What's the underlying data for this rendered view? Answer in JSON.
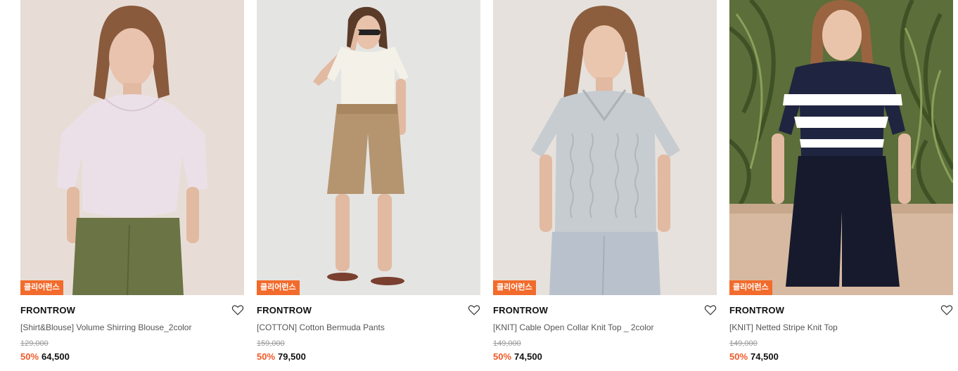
{
  "colors": {
    "badge": "#f26b2c",
    "discount": "#f05a28"
  },
  "products": [
    {
      "badge": "클리어런스",
      "brand": "FRONTROW",
      "name": "[Shirt&Blouse] Volume Shirring Blouse_2color",
      "original_price": "129,000",
      "discount": "50%",
      "price": "64,500",
      "icon": "heart-icon"
    },
    {
      "badge": "클리어런스",
      "brand": "FRONTROW",
      "name": "[COTTON] Cotton Bermuda Pants",
      "original_price": "159,000",
      "discount": "50%",
      "price": "79,500",
      "icon": "heart-icon"
    },
    {
      "badge": "클리어런스",
      "brand": "FRONTROW",
      "name": "[KNIT] Cable Open Collar Knit Top _ 2color",
      "original_price": "149,000",
      "discount": "50%",
      "price": "74,500",
      "icon": "heart-icon"
    },
    {
      "badge": "클리어런스",
      "brand": "FRONTROW",
      "name": "[KNIT] Netted Stripe Knit Top",
      "original_price": "149,000",
      "discount": "50%",
      "price": "74,500",
      "icon": "heart-icon"
    }
  ]
}
